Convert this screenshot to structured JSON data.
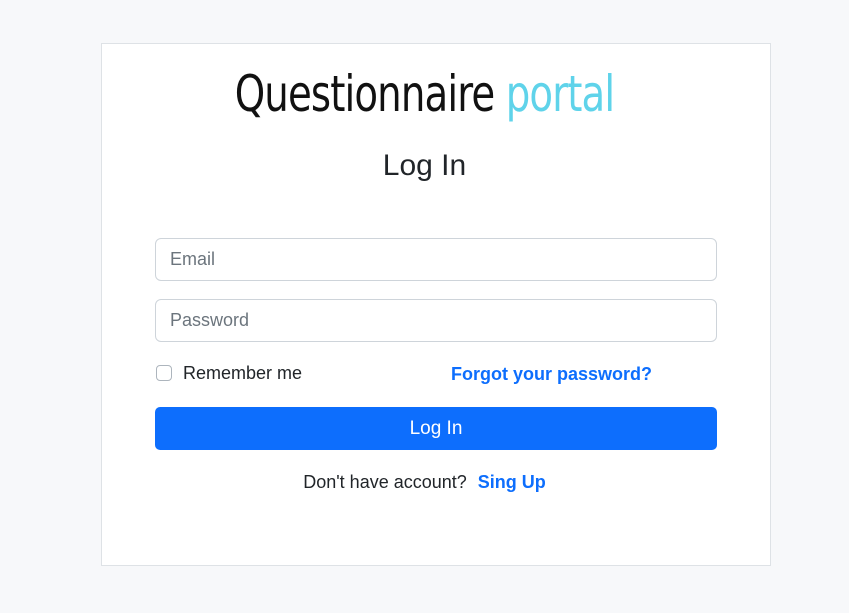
{
  "brand": {
    "main": "Questionnaire",
    "accent": "portal",
    "accent_color": "#5fd3ea"
  },
  "form": {
    "title": "Log In",
    "email_placeholder": "Email",
    "email_value": "",
    "password_placeholder": "Password",
    "password_value": "",
    "remember_label": "Remember me",
    "remember_checked": false,
    "forgot_link": "Forgot your password?",
    "submit_label": "Log In",
    "signup_prompt": "Don't have account?",
    "signup_link": "Sing Up"
  },
  "colors": {
    "primary": "#0d6efd",
    "background": "#f7f8fa",
    "card": "#ffffff"
  }
}
